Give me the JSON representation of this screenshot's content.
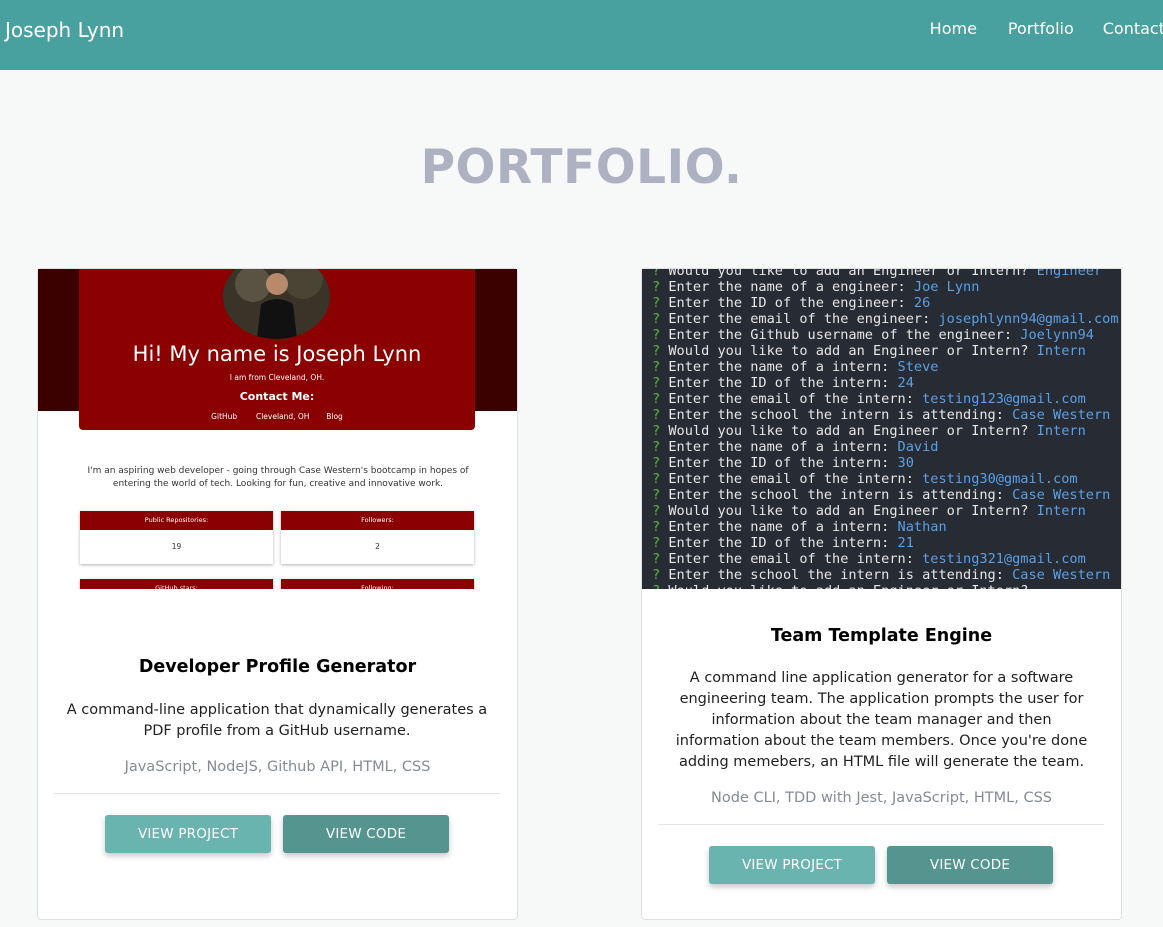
{
  "navbar": {
    "brand": "Joseph Lynn",
    "links": [
      "Home",
      "Portfolio",
      "Contact"
    ],
    "background": "#48a19f"
  },
  "page_title": "PORTFOLIO.",
  "projects": [
    {
      "title": "Developer Profile Generator",
      "description": "A command-line application that dynamically generates a PDF profile from a GitHub username.",
      "technologies": "JavaScript, NodeJS, Github API, HTML, CSS",
      "view_project_label": "VIEW PROJECT",
      "view_code_label": "VIEW CODE",
      "thumbnail": {
        "heading": "Hi! My name is Joseph Lynn",
        "location_line": "I am from Cleveland, OH.",
        "contact_heading": "Contact Me:",
        "contact_links": [
          "GitHub",
          "Cleveland, OH",
          "Blog"
        ],
        "about": "I'm an aspiring web developer - going through Case Western's bootcamp in hopes of entering the world of tech. Looking for fun, creative and innovative work.",
        "stats": [
          {
            "label": "Public Repositories:",
            "value": "19"
          },
          {
            "label": "Followers:",
            "value": "2"
          },
          {
            "label": "GitHub stars:",
            "value": ""
          },
          {
            "label": "Following:",
            "value": ""
          }
        ]
      }
    },
    {
      "title": "Team Template Engine",
      "description": "A command line application generator for a software engineering team. The application prompts the user for information about the team manager and then information about the team members. Once you're done adding memebers, an HTML file will generate the team.",
      "technologies": "Node CLI, TDD with Jest, JavaScript, HTML, CSS",
      "view_project_label": "VIEW PROJECT",
      "view_code_label": "VIEW CODE",
      "thumbnail": {
        "terminal_lines": [
          {
            "q": "Would you like to add an Engineer or Intern?",
            "a": "Engineer"
          },
          {
            "q": "Enter the name of a engineer:",
            "a": "Joe Lynn"
          },
          {
            "q": "Enter the ID of the engineer:",
            "a": "26"
          },
          {
            "q": "Enter the email of the engineer:",
            "a": "josephlynn94@gmail.com"
          },
          {
            "q": "Enter the Github username of the engineer:",
            "a": "Joelynn94"
          },
          {
            "q": "Would you like to add an Engineer or Intern?",
            "a": "Intern"
          },
          {
            "q": "Enter the name of a intern:",
            "a": "Steve"
          },
          {
            "q": "Enter the ID of the intern:",
            "a": "24"
          },
          {
            "q": "Enter the email of the intern:",
            "a": "testing123@gmail.com"
          },
          {
            "q": "Enter the school the intern is attending:",
            "a": "Case Western"
          },
          {
            "q": "Would you like to add an Engineer or Intern?",
            "a": "Intern"
          },
          {
            "q": "Enter the name of a intern:",
            "a": "David"
          },
          {
            "q": "Enter the ID of the intern:",
            "a": "30"
          },
          {
            "q": "Enter the email of the intern:",
            "a": "testing30@gmail.com"
          },
          {
            "q": "Enter the school the intern is attending:",
            "a": "Case Western"
          },
          {
            "q": "Would you like to add an Engineer or Intern?",
            "a": "Intern"
          },
          {
            "q": "Enter the name of a intern:",
            "a": "Nathan"
          },
          {
            "q": "Enter the ID of the intern:",
            "a": "21"
          },
          {
            "q": "Enter the email of the intern:",
            "a": "testing321@gmail.com"
          },
          {
            "q": "Enter the school the intern is attending:",
            "a": "Case Western"
          },
          {
            "q": "Would you like to add an Engineer or Intern?",
            "a": ""
          }
        ]
      }
    }
  ]
}
